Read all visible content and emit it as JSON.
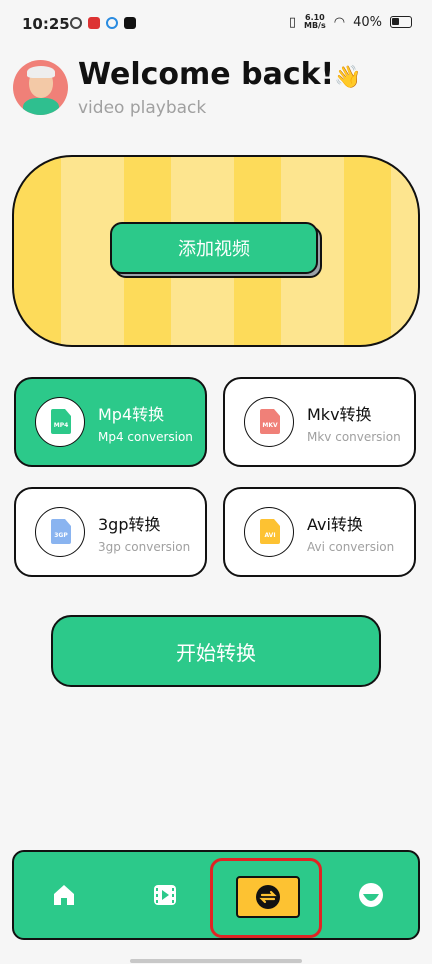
{
  "status": {
    "time": "10:25",
    "net_speed_top": "6.10",
    "net_speed_unit": "MB/s",
    "battery": "40%"
  },
  "header": {
    "title": "Welcome back!",
    "wave_emoji": "👋",
    "subtitle": "video playback"
  },
  "banner": {
    "add_video_label": "添加视频"
  },
  "cards": [
    {
      "title": "Mp4转换",
      "subtitle": "Mp4 conversion",
      "tag": "MP4",
      "color": "#2cc98a"
    },
    {
      "title": "Mkv转换",
      "subtitle": "Mkv conversion",
      "tag": "MKV",
      "color": "#f08078"
    },
    {
      "title": "3gp转换",
      "subtitle": "3gp conversion",
      "tag": "3GP",
      "color": "#8ab4f0"
    },
    {
      "title": "Avi转换",
      "subtitle": "Avi conversion",
      "tag": "AVI",
      "color": "#fdc232"
    }
  ],
  "start_button": "开始转换",
  "colors": {
    "accent": "#2cc98a",
    "banner_yellow": "#fddb5a",
    "nav_active": "#fdc232",
    "highlight": "#e02424"
  },
  "nav": [
    {
      "icon": "home-icon"
    },
    {
      "icon": "video-icon"
    },
    {
      "icon": "convert-icon"
    },
    {
      "icon": "profile-icon"
    }
  ]
}
